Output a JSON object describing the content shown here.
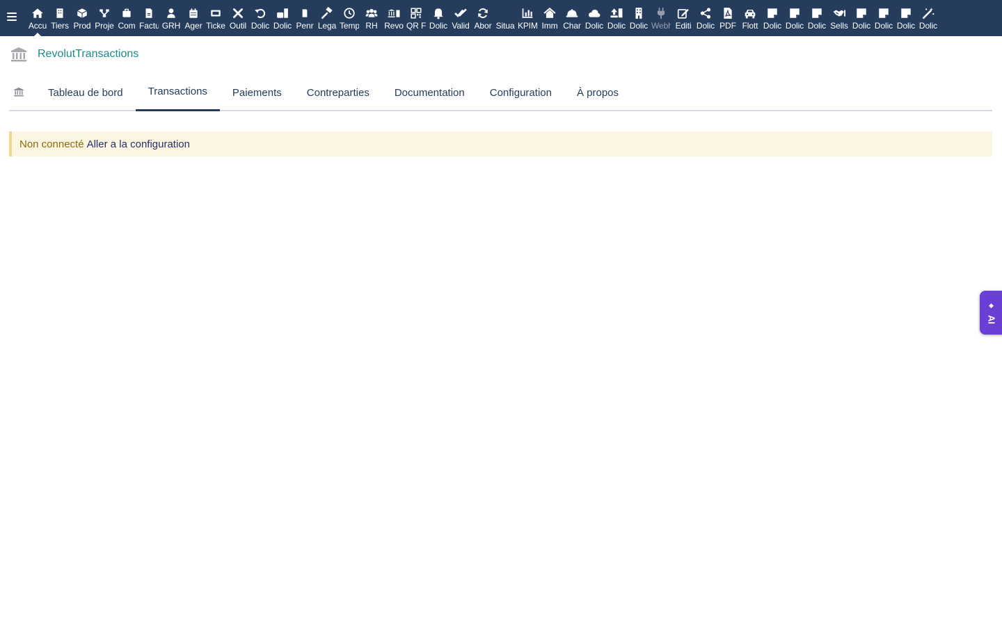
{
  "topbar": {
    "menu_items": [
      {
        "label": "Accu",
        "icon": "home-icon",
        "active": true
      },
      {
        "label": "Tiers",
        "icon": "building-icon"
      },
      {
        "label": "Prod",
        "icon": "cube-icon"
      },
      {
        "label": "Proje",
        "icon": "sitemap-icon"
      },
      {
        "label": "Com",
        "icon": "briefcase-icon"
      },
      {
        "label": "Factu",
        "icon": "invoice-icon"
      },
      {
        "label": "GRH",
        "icon": "person-icon"
      },
      {
        "label": "Ager",
        "icon": "calendar-icon"
      },
      {
        "label": "Ticke",
        "icon": "ticket-icon"
      },
      {
        "label": "Outil",
        "icon": "tools-icon"
      },
      {
        "label": "Dolic",
        "icon": "undo-icon"
      },
      {
        "label": "Dolic",
        "icon": "briefcase-doc-icon"
      },
      {
        "label": "Penr",
        "icon": "doc-icon"
      },
      {
        "label": "Lega",
        "icon": "gavel-icon"
      },
      {
        "label": "Temp",
        "icon": "clock-icon"
      },
      {
        "label": "RH",
        "icon": "users-icon"
      },
      {
        "label": "Revo",
        "icon": "bank-doc-icon"
      },
      {
        "label": "QR F",
        "icon": "qrcode-icon"
      },
      {
        "label": "Dolic",
        "icon": "bell-icon"
      },
      {
        "label": "Valid",
        "icon": "double-check-icon"
      },
      {
        "label": "Abor",
        "icon": "refresh-icon"
      },
      {
        "label": "Situa",
        "icon": "blank-icon"
      },
      {
        "label": "KPIM",
        "icon": "bar-chart-icon"
      },
      {
        "label": "Imm",
        "icon": "house-icon"
      },
      {
        "label": "Char",
        "icon": "hard-hat-icon"
      },
      {
        "label": "Dolic",
        "icon": "cloud-icon"
      },
      {
        "label": "Dolic",
        "icon": "upload-icon"
      },
      {
        "label": "Dolic",
        "icon": "office-icon"
      },
      {
        "label": "Webh",
        "icon": "plug-icon",
        "dim": true
      },
      {
        "label": "Editi",
        "icon": "edit-icon"
      },
      {
        "label": "Dolic",
        "icon": "share-icon"
      },
      {
        "label": "PDF",
        "icon": "pdf-icon"
      },
      {
        "label": "Flott",
        "icon": "car-icon"
      },
      {
        "label": "Dolic",
        "icon": "note-icon"
      },
      {
        "label": "Dolic",
        "icon": "note-icon"
      },
      {
        "label": "Dolic",
        "icon": "note-icon"
      },
      {
        "label": "Sells",
        "icon": "handshake-icon"
      },
      {
        "label": "Dolic",
        "icon": "note-icon"
      },
      {
        "label": "Dolic",
        "icon": "note-icon"
      },
      {
        "label": "Dolic",
        "icon": "note-icon"
      },
      {
        "label": "Dolic",
        "icon": "magic-wand-icon"
      }
    ]
  },
  "module": {
    "title": "RevolutTransactions",
    "icon": "bank-icon"
  },
  "tabs": [
    {
      "label": "Tableau de bord"
    },
    {
      "label": "Transactions",
      "active": true
    },
    {
      "label": "Paiements"
    },
    {
      "label": "Contreparties"
    },
    {
      "label": "Documentation"
    },
    {
      "label": "Configuration"
    },
    {
      "label": "À propos"
    }
  ],
  "warning": {
    "text": "Non connecté",
    "link": "Aller a la configuration"
  },
  "ai_button": {
    "label": "AI"
  },
  "colors": {
    "topbar": "#263c5c",
    "module_title": "#1b8a8a",
    "warning_bg": "#fcf6e2",
    "ai_button": "#6a3fd6"
  }
}
